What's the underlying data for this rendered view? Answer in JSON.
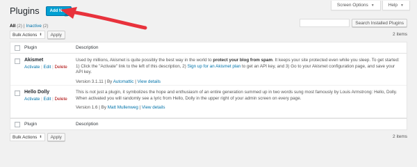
{
  "header": {
    "screen_options": "Screen Options",
    "help": "Help",
    "title": "Plugins",
    "add_new": "Add New"
  },
  "filters": {
    "all_label": "All",
    "all_count": "(2)",
    "separator": "|",
    "inactive_label": "Inactive",
    "inactive_count": "(2)"
  },
  "search": {
    "button": "Search Installed Plugins",
    "value": ""
  },
  "bulk": {
    "select_value": "Bulk Actions",
    "apply": "Apply"
  },
  "items_count": "2 items",
  "table": {
    "col_plugin": "Plugin",
    "col_desc": "Description",
    "rows": [
      {
        "name": "Akismet",
        "activate": "Activate",
        "edit": "Edit",
        "delete": "Delete",
        "desc_1": "Used by millions, Akismet is quite possibly the best way in the world to ",
        "desc_bold": "protect your blog from spam",
        "desc_2": ". It keeps your site protected even while you sleep. To get started: 1) Click the \"Activate\" link to the left of this description, 2) ",
        "desc_link": "Sign up for an Akismet plan",
        "desc_3": " to get an API key, and 3) Go to your Akismet configuration page, and save your API key.",
        "version": "Version 3.1.11",
        "by": "By",
        "author": "Automattic",
        "details": "View details"
      },
      {
        "name": "Hello Dolly",
        "activate": "Activate",
        "edit": "Edit",
        "delete": "Delete",
        "desc_1": "This is not just a plugin, it symbolizes the hope and enthusiasm of an entire generation summed up in two words sung most famously by Louis Armstrong: Hello, Dolly. When activated you will randomly see a lyric from Hello, Dolly in the upper right of your admin screen on every page.",
        "version": "Version 1.6",
        "by": "By",
        "author": "Matt Mullenweg",
        "details": "View details"
      }
    ]
  },
  "colors": {
    "accent": "#0073aa",
    "button_primary": "#00a0d2",
    "delete": "#a00",
    "annotation_arrow": "#e8323c"
  }
}
